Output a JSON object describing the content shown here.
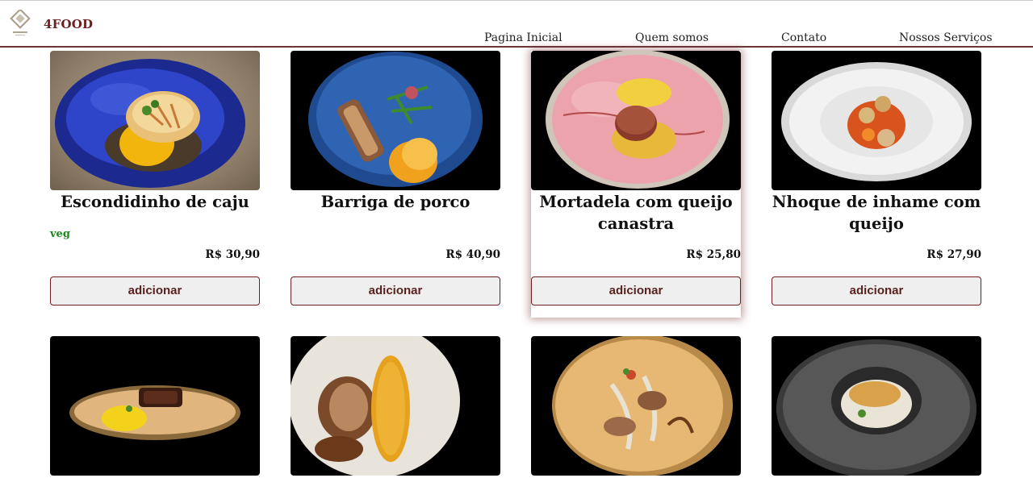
{
  "brand": {
    "name": "4FOOD"
  },
  "nav": {
    "items": [
      "Pagina Inicial",
      "Quem somos",
      "Contato",
      "Nossos Serviços"
    ]
  },
  "products": [
    {
      "name": "Escondidinho de caju",
      "tag": "veg",
      "price": "R$ 30,90",
      "button": "adicionar"
    },
    {
      "name": "Barriga de porco",
      "tag": "",
      "price": "R$ 40,90",
      "button": "adicionar"
    },
    {
      "name": "Mortadela com queijo canastra",
      "tag": "",
      "price": "R$ 25,80",
      "button": "adicionar"
    },
    {
      "name": "Nhoque de inhame com queijo",
      "tag": "",
      "price": "R$ 27,90",
      "button": "adicionar"
    }
  ],
  "colors": {
    "brand": "#6b1f1f",
    "veg": "#1f8a1f",
    "divider": "#6b3636"
  }
}
